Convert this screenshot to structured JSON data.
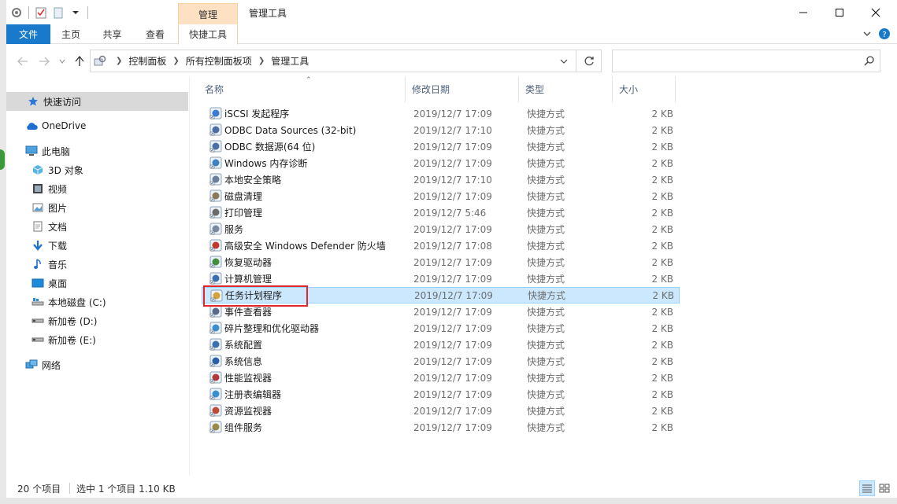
{
  "title_bar": {
    "context_tab": "管理",
    "window_title": "管理工具",
    "quick_access": [
      "properties-icon",
      "check-icon",
      "new-folder-icon",
      "dropdown-icon"
    ]
  },
  "ribbon": {
    "tabs": [
      "文件",
      "主页",
      "共享",
      "查看",
      "快捷工具"
    ],
    "active_tab": "文件",
    "accent": "#1979ca",
    "context_color": "#fde1c2"
  },
  "address": {
    "crumbs": [
      "控制面板",
      "所有控制面板项",
      "管理工具"
    ],
    "search_placeholder": ""
  },
  "nav": {
    "items": [
      {
        "label": "快速访问",
        "icon": "star-icon"
      },
      {
        "label": "OneDrive",
        "icon": "cloud-icon"
      },
      {
        "label": "此电脑",
        "icon": "computer-icon"
      },
      {
        "label": "3D 对象",
        "icon": "3d-object-icon"
      },
      {
        "label": "视频",
        "icon": "video-icon"
      },
      {
        "label": "图片",
        "icon": "picture-icon"
      },
      {
        "label": "文档",
        "icon": "document-icon"
      },
      {
        "label": "下载",
        "icon": "download-icon"
      },
      {
        "label": "音乐",
        "icon": "music-icon"
      },
      {
        "label": "桌面",
        "icon": "desktop-icon"
      },
      {
        "label": "本地磁盘 (C:)",
        "icon": "drive-icon"
      },
      {
        "label": "新加卷 (D:)",
        "icon": "drive-icon"
      },
      {
        "label": "新加卷 (E:)",
        "icon": "drive-icon"
      },
      {
        "label": "网络",
        "icon": "network-icon"
      }
    ],
    "selected": "快速访问"
  },
  "columns": [
    "名称",
    "修改日期",
    "类型",
    "大小"
  ],
  "files": [
    {
      "name": "iSCSI 发起程序",
      "date": "2019/12/7 17:09",
      "type": "快捷方式",
      "size": "2 KB"
    },
    {
      "name": "ODBC Data Sources (32-bit)",
      "date": "2019/12/7 17:10",
      "type": "快捷方式",
      "size": "2 KB"
    },
    {
      "name": "ODBC 数据源(64 位)",
      "date": "2019/12/7 17:09",
      "type": "快捷方式",
      "size": "2 KB"
    },
    {
      "name": "Windows 内存诊断",
      "date": "2019/12/7 17:09",
      "type": "快捷方式",
      "size": "2 KB"
    },
    {
      "name": "本地安全策略",
      "date": "2019/12/7 17:10",
      "type": "快捷方式",
      "size": "2 KB"
    },
    {
      "name": "磁盘清理",
      "date": "2019/12/7 17:09",
      "type": "快捷方式",
      "size": "2 KB"
    },
    {
      "name": "打印管理",
      "date": "2019/12/7 5:46",
      "type": "快捷方式",
      "size": "2 KB"
    },
    {
      "name": "服务",
      "date": "2019/12/7 17:09",
      "type": "快捷方式",
      "size": "2 KB"
    },
    {
      "name": "高级安全 Windows Defender 防火墙",
      "date": "2019/12/7 17:08",
      "type": "快捷方式",
      "size": "2 KB"
    },
    {
      "name": "恢复驱动器",
      "date": "2019/12/7 17:09",
      "type": "快捷方式",
      "size": "2 KB"
    },
    {
      "name": "计算机管理",
      "date": "2019/12/7 17:09",
      "type": "快捷方式",
      "size": "2 KB"
    },
    {
      "name": "任务计划程序",
      "date": "2019/12/7 17:09",
      "type": "快捷方式",
      "size": "2 KB",
      "selected": true
    },
    {
      "name": "事件查看器",
      "date": "2019/12/7 17:09",
      "type": "快捷方式",
      "size": "2 KB"
    },
    {
      "name": "碎片整理和优化驱动器",
      "date": "2019/12/7 17:09",
      "type": "快捷方式",
      "size": "2 KB"
    },
    {
      "name": "系统配置",
      "date": "2019/12/7 17:09",
      "type": "快捷方式",
      "size": "2 KB"
    },
    {
      "name": "系统信息",
      "date": "2019/12/7 17:09",
      "type": "快捷方式",
      "size": "2 KB"
    },
    {
      "name": "性能监视器",
      "date": "2019/12/7 17:09",
      "type": "快捷方式",
      "size": "2 KB"
    },
    {
      "name": "注册表编辑器",
      "date": "2019/12/7 17:09",
      "type": "快捷方式",
      "size": "2 KB"
    },
    {
      "name": "资源监视器",
      "date": "2019/12/7 17:09",
      "type": "快捷方式",
      "size": "2 KB"
    },
    {
      "name": "组件服务",
      "date": "2019/12/7 17:09",
      "type": "快捷方式",
      "size": "2 KB"
    }
  ],
  "status": {
    "count": "20 个项目",
    "selection": "选中 1 个项目  1.10 KB"
  },
  "colors": {
    "selection_bg": "#cce8ff",
    "selection_border": "#99d1ff",
    "annotation_red": "#e0262a"
  }
}
